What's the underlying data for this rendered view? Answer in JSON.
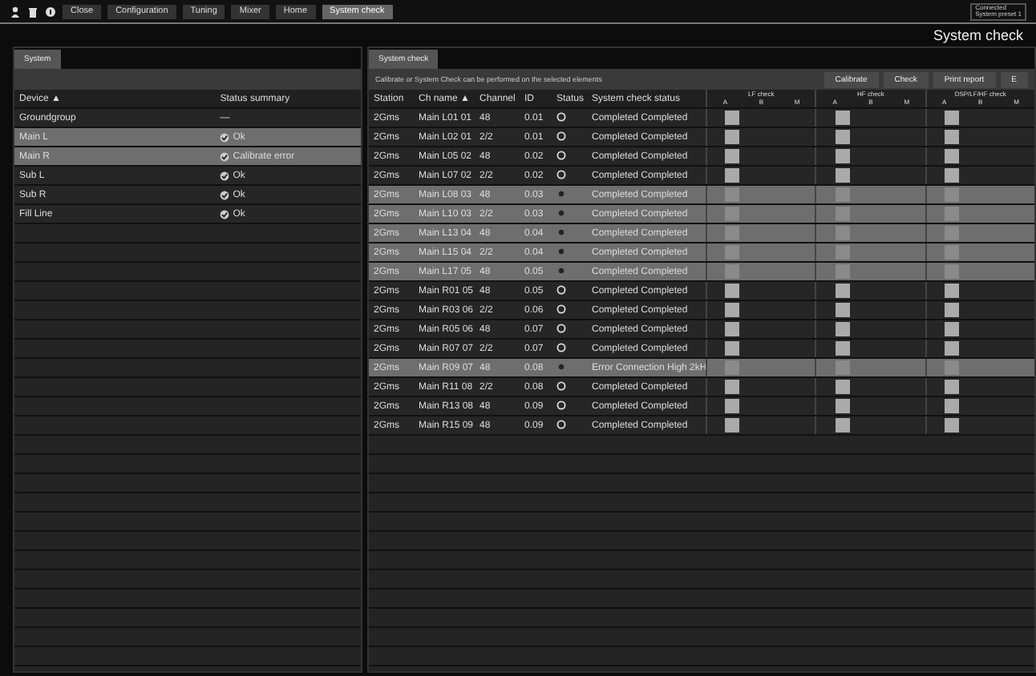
{
  "toolbar": {
    "buttons": [
      {
        "label": "Close",
        "selected": false
      },
      {
        "label": "Configuration",
        "selected": false
      },
      {
        "label": "Tuning",
        "selected": false
      },
      {
        "label": "Mixer",
        "selected": false
      },
      {
        "label": "Home",
        "selected": false
      },
      {
        "label": "System check",
        "selected": true
      }
    ],
    "connection": [
      "Connected",
      "System preset 1"
    ]
  },
  "page_title": "System check",
  "system_panel": {
    "tab": "System",
    "columns": [
      "Device ▲",
      "Status summary"
    ],
    "rows": [
      {
        "device": "Groundgroup",
        "status": "—",
        "checked": false,
        "selected": false
      },
      {
        "device": "Main L",
        "status": "Ok",
        "checked": true,
        "selected": true
      },
      {
        "device": "Main R",
        "status": "Calibrate error",
        "checked": true,
        "selected": true
      },
      {
        "device": "Sub L",
        "status": "Ok",
        "checked": true,
        "selected": false
      },
      {
        "device": "Sub R",
        "status": "Ok",
        "checked": true,
        "selected": false
      },
      {
        "device": "Fill Line",
        "status": "Ok",
        "checked": true,
        "selected": false
      }
    ]
  },
  "check_panel": {
    "tab": "System check",
    "info": "Calibrate or System Check can be performed on the selected elements",
    "buttons": [
      "Calibrate",
      "Check",
      "Print report",
      "E"
    ],
    "columns": [
      "Station",
      "Ch name ▲",
      "Channel",
      "ID",
      "Status",
      "System check status"
    ],
    "groups": [
      {
        "title": "LF check",
        "sub": [
          "A",
          "B",
          "M"
        ]
      },
      {
        "title": "HF check",
        "sub": [
          "A",
          "B",
          "M"
        ]
      },
      {
        "title": "DSP/LF/HF check",
        "sub": [
          "A",
          "B",
          "M"
        ]
      }
    ],
    "rows": [
      {
        "cells": [
          "2Gms",
          "Main L01 01",
          "48",
          "0.01"
        ],
        "check": "Completed Completed",
        "selected": false
      },
      {
        "cells": [
          "2Gms",
          "Main L02 01",
          "2/2",
          "0.01"
        ],
        "check": "Completed Completed",
        "selected": false
      },
      {
        "cells": [
          "2Gms",
          "Main L05 02",
          "48",
          "0.02"
        ],
        "check": "Completed Completed",
        "selected": false
      },
      {
        "cells": [
          "2Gms",
          "Main L07 02",
          "2/2",
          "0.02"
        ],
        "check": "Completed Completed",
        "selected": false
      },
      {
        "cells": [
          "2Gms",
          "Main L08 03",
          "48",
          "0.03"
        ],
        "check": "Completed Completed",
        "selected": true
      },
      {
        "cells": [
          "2Gms",
          "Main L10 03",
          "2/2",
          "0.03"
        ],
        "check": "Completed Completed",
        "selected": true
      },
      {
        "cells": [
          "2Gms",
          "Main L13 04",
          "48",
          "0.04"
        ],
        "check": "Completed Completed",
        "selected": true
      },
      {
        "cells": [
          "2Gms",
          "Main L15 04",
          "2/2",
          "0.04"
        ],
        "check": "Completed Completed",
        "selected": true
      },
      {
        "cells": [
          "2Gms",
          "Main L17 05",
          "48",
          "0.05"
        ],
        "check": "Completed Completed",
        "selected": true
      },
      {
        "cells": [
          "2Gms",
          "Main R01 05",
          "48",
          "0.05"
        ],
        "check": "Completed Completed",
        "selected": false
      },
      {
        "cells": [
          "2Gms",
          "Main R03 06",
          "2/2",
          "0.06"
        ],
        "check": "Completed Completed",
        "selected": false
      },
      {
        "cells": [
          "2Gms",
          "Main R05 06",
          "48",
          "0.07"
        ],
        "check": "Completed Completed",
        "selected": false
      },
      {
        "cells": [
          "2Gms",
          "Main R07 07",
          "2/2",
          "0.07"
        ],
        "check": "Completed Completed",
        "selected": false
      },
      {
        "cells": [
          "2Gms",
          "Main R09 07",
          "48",
          "0.08"
        ],
        "check": "Error Connection High 2kH",
        "selected": true
      },
      {
        "cells": [
          "2Gms",
          "Main R11 08",
          "2/2",
          "0.08"
        ],
        "check": "Completed Completed",
        "selected": false
      },
      {
        "cells": [
          "2Gms",
          "Main R13 08",
          "48",
          "0.09"
        ],
        "check": "Completed Completed",
        "selected": false
      },
      {
        "cells": [
          "2Gms",
          "Main R15 09",
          "48",
          "0.09"
        ],
        "check": "Completed Completed",
        "selected": false
      }
    ]
  }
}
